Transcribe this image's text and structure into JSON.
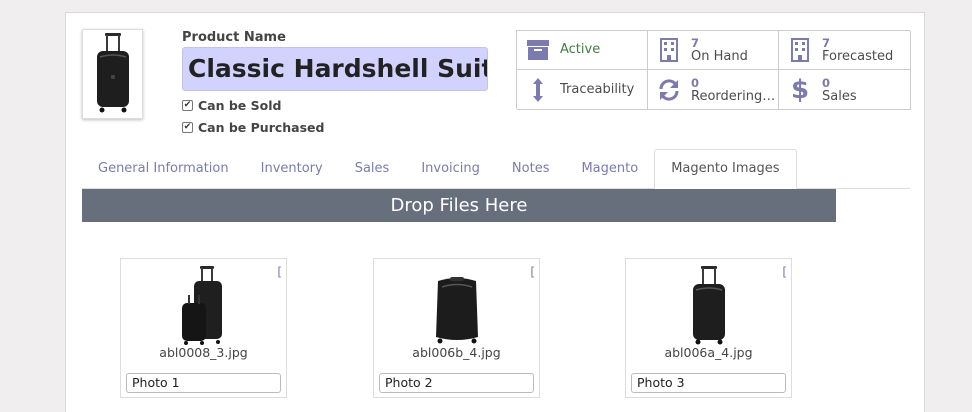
{
  "product": {
    "name_label": "Product Name",
    "name_value": "Classic Hardshell Suitcase",
    "can_be_sold_label": "Can be Sold",
    "can_be_purchased_label": "Can be Purchased",
    "can_be_sold": true,
    "can_be_purchased": true
  },
  "stats": [
    {
      "name": "active",
      "label": "Active",
      "count": "",
      "icon": "archive-icon"
    },
    {
      "name": "on-hand",
      "label": "On Hand",
      "count": "7",
      "icon": "building-icon"
    },
    {
      "name": "forecasted",
      "label": "Forecasted",
      "count": "7",
      "icon": "building-icon"
    },
    {
      "name": "traceability",
      "label": "Traceability",
      "count": "",
      "icon": "arrows-vertical-icon"
    },
    {
      "name": "reordering-rules",
      "label": "Reordering R...",
      "count": "0",
      "icon": "refresh-icon"
    },
    {
      "name": "sales",
      "label": "Sales",
      "count": "0",
      "icon": "dollar-icon"
    }
  ],
  "tabs": [
    {
      "label": "General Information",
      "active": false
    },
    {
      "label": "Inventory",
      "active": false
    },
    {
      "label": "Sales",
      "active": false
    },
    {
      "label": "Invoicing",
      "active": false
    },
    {
      "label": "Notes",
      "active": false
    },
    {
      "label": "Magento",
      "active": false
    },
    {
      "label": "Magento Images",
      "active": true
    }
  ],
  "dropzone": {
    "label": "Drop Files Here"
  },
  "images": [
    {
      "filename": "abl0008_3.jpg",
      "caption": "Photo 1",
      "delete_label": "["
    },
    {
      "filename": "abl006b_4.jpg",
      "caption": "Photo 2",
      "delete_label": "["
    },
    {
      "filename": "abl006a_4.jpg",
      "caption": "Photo 3",
      "delete_label": "["
    }
  ],
  "colors": {
    "accent": "#7c7bad",
    "dropzone": "#676f7d",
    "name_field": "#d2d2ff",
    "active_green": "#3f7d3f"
  }
}
